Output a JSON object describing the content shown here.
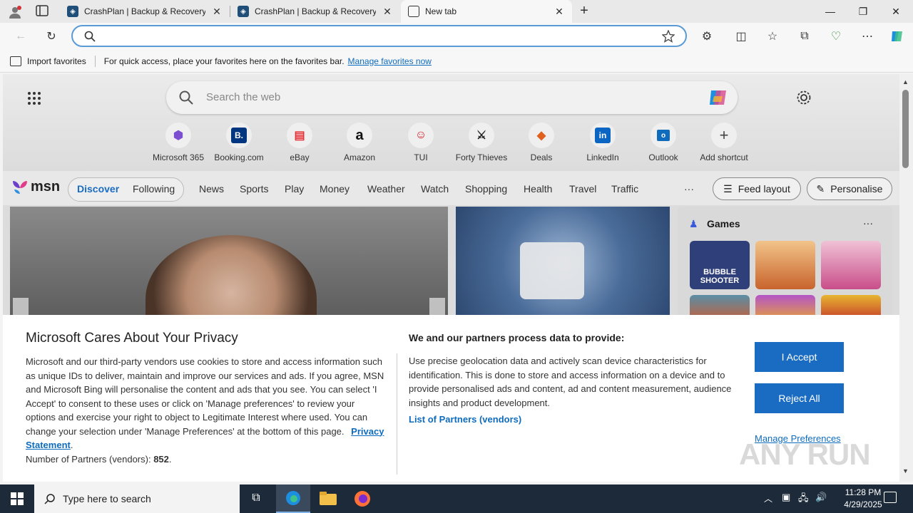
{
  "tabs": [
    {
      "title": "CrashPlan | Backup & Recovery S"
    },
    {
      "title": "CrashPlan | Backup & Recovery S"
    },
    {
      "title": "New tab"
    }
  ],
  "favorites_bar": {
    "import_label": "Import favorites",
    "hint": "For quick access, place your favorites here on the favorites bar.",
    "manage_link": "Manage favorites now"
  },
  "newtab": {
    "search_placeholder": "Search the web",
    "shortcuts": [
      {
        "label": "Microsoft 365",
        "icon": "microsoft365-icon"
      },
      {
        "label": "Booking.com",
        "icon": "booking-icon"
      },
      {
        "label": "eBay",
        "icon": "ebay-icon"
      },
      {
        "label": "Amazon",
        "icon": "amazon-icon"
      },
      {
        "label": "TUI",
        "icon": "tui-icon"
      },
      {
        "label": "Forty Thieves",
        "icon": "forty-thieves-icon"
      },
      {
        "label": "Deals",
        "icon": "deals-icon"
      },
      {
        "label": "LinkedIn",
        "icon": "linkedin-icon"
      },
      {
        "label": "Outlook",
        "icon": "outlook-icon"
      },
      {
        "label": "Add shortcut",
        "icon": "plus-icon"
      }
    ]
  },
  "msn": {
    "logo": "msn",
    "tabs": [
      "Discover",
      "Following"
    ],
    "categories": [
      "News",
      "Sports",
      "Play",
      "Money",
      "Weather",
      "Watch",
      "Shopping",
      "Health",
      "Travel",
      "Traffic"
    ],
    "more": "···",
    "feed_layout": "Feed layout",
    "personalise": "Personalise",
    "games_title": "Games",
    "games_more": "···",
    "bubble_shooter": "BUBBLE SHOOTER"
  },
  "privacy": {
    "title": "Microsoft Cares About Your Privacy",
    "body": "Microsoft and our third-party vendors use cookies to store and access information such as unique IDs to deliver, maintain and improve our services and ads. If you agree, MSN and Microsoft Bing will personalise the content and ads that you see. You can select 'I Accept' to consent to these uses or click on 'Manage preferences' to review your options and exercise your right to object to Legitimate Interest where used.  You can change your selection under 'Manage Preferences' at the bottom of this page.",
    "privacy_link": "Privacy Statement",
    "partners_label": "Number of Partners (vendors):",
    "partners_count": "852",
    "right_title": "We and our partners process data to provide:",
    "right_body": "Use precise geolocation data and actively scan device characteristics for identification. This is done to store and access information on a device and to provide personalised ads and content, ad and content measurement, audience insights and product development.",
    "partners_link": "List of Partners (vendors)",
    "accept": "I Accept",
    "reject": "Reject All",
    "manage": "Manage Preferences"
  },
  "watermark": "ANY RUN",
  "taskbar": {
    "search_placeholder": "Type here to search",
    "time": "11:28 PM",
    "date": "4/29/2025"
  },
  "colors": {
    "accent": "#1a6cc3",
    "link": "#0f6cbd",
    "taskbar": "#1c2a3a"
  }
}
